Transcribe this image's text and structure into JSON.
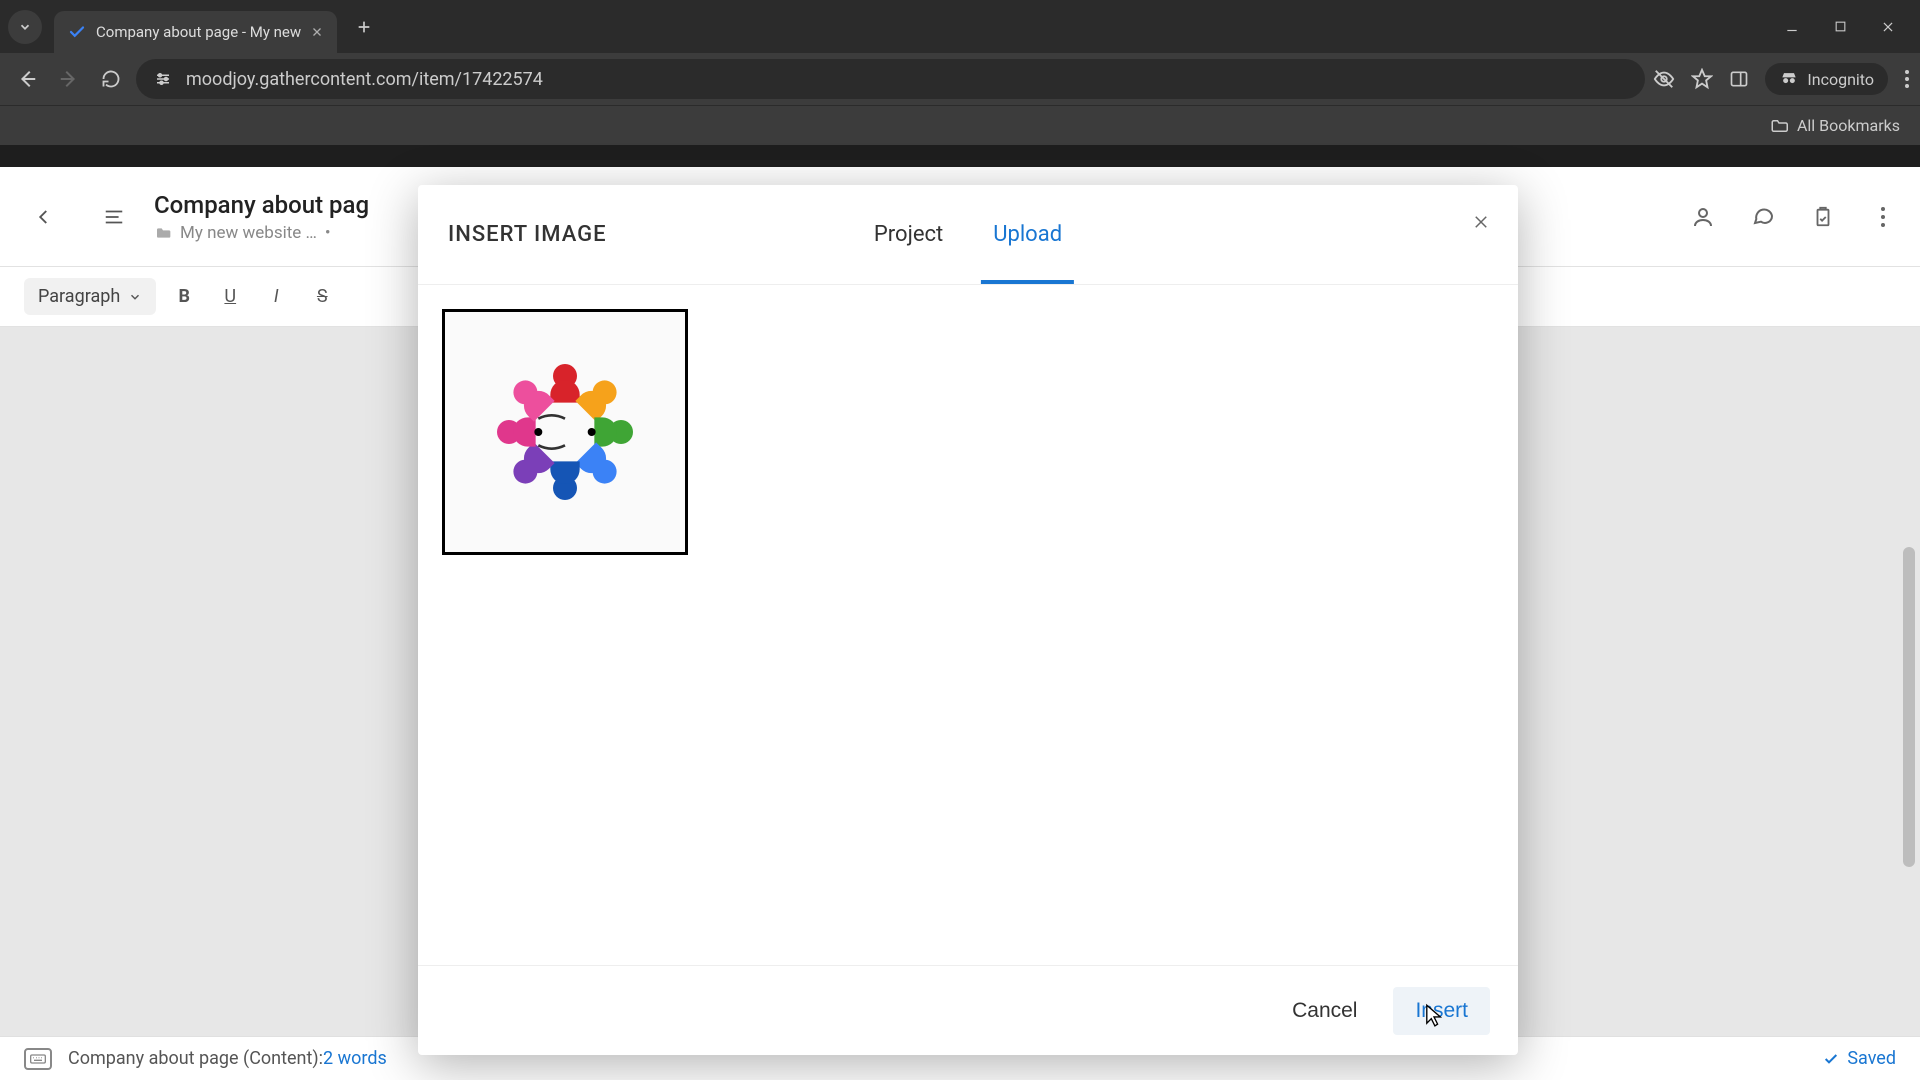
{
  "browser": {
    "tab_title": "Company about page - My new",
    "url": "moodjoy.gathercontent.com/item/17422574",
    "incognito_label": "Incognito",
    "all_bookmarks": "All Bookmarks"
  },
  "app": {
    "doc_title": "Company about pag",
    "breadcrumb_project": "My new website …",
    "breadcrumb_separator": "•"
  },
  "toolbar": {
    "style_label": "Paragraph"
  },
  "modal": {
    "title": "INSERT IMAGE",
    "tabs": {
      "project": "Project",
      "upload": "Upload"
    },
    "cancel_label": "Cancel",
    "insert_label": "Insert"
  },
  "statusbar": {
    "doc_label": "Company about page (Content): ",
    "word_count": "2 words",
    "saved_label": "Saved"
  }
}
